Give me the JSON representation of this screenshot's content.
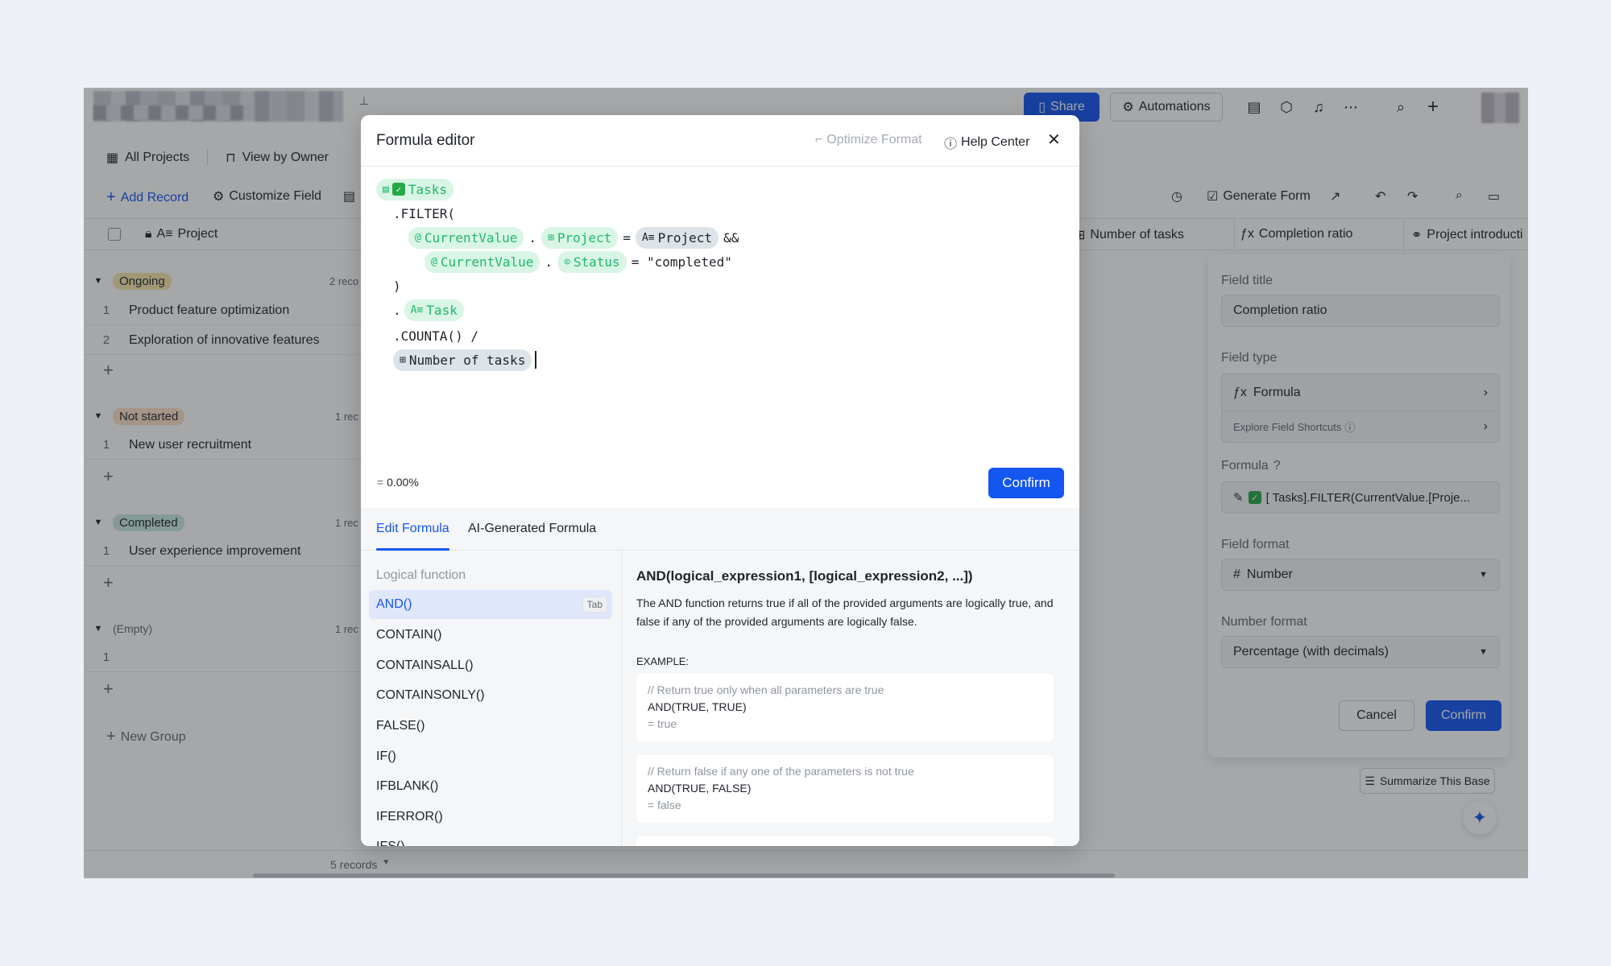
{
  "topbar": {
    "share_label": "Share",
    "automations_label": "Automations"
  },
  "views": [
    "All Projects",
    "View by Owner"
  ],
  "toolbar": {
    "add_record": "Add Record",
    "customize_field": "Customize Field",
    "generate_form": "Generate Form"
  },
  "grid": {
    "columns": [
      "Project",
      "Number of tasks",
      "Completion ratio",
      "Project introducti"
    ],
    "groups": [
      {
        "tag": "Ongoing",
        "count": "2 reco",
        "tag_color": "#f8e6ab",
        "rows": [
          "Product feature optimization",
          "Exploration of innovative features"
        ]
      },
      {
        "tag": "Not started",
        "count": "1 rec",
        "tag_color": "#fde2c6",
        "rows": [
          "New user recruitment"
        ]
      },
      {
        "tag": "Completed",
        "count": "1 rec",
        "tag_color": "#cae9e2",
        "rows": [
          "User experience improvement"
        ]
      },
      {
        "tag": "(Empty)",
        "count": "1 rec",
        "rows": [
          ""
        ]
      }
    ],
    "new_group": "New Group",
    "records": "5 records"
  },
  "field_panel": {
    "field_title_label": "Field title",
    "field_title_value": "Completion ratio",
    "field_type_label": "Field type",
    "field_type_value": "Formula",
    "shortcuts": "Explore Field Shortcuts",
    "formula_label": "Formula",
    "formula_value": "[ Tasks].FILTER(CurrentValue.[Proje...",
    "format_label": "Field format",
    "format_value": "Number",
    "number_format_label": "Number format",
    "number_format_value": "Percentage (with decimals)",
    "cancel": "Cancel",
    "confirm": "Confirm",
    "summarize": "Summarize This Base"
  },
  "modal": {
    "title": "Formula editor",
    "optimize": "Optimize Format",
    "help": "Help Center",
    "formula": {
      "tasks": "Tasks",
      "filter": ".FILTER(",
      "current_value": "CurrentValue",
      "project_field": "Project",
      "project_ref": "Project",
      "and_op": "&&",
      "status_field": "Status",
      "completed_str": "= \"completed\"",
      "close_paren": ")",
      "dot": ".",
      "task_field": "Task",
      "counta": ".COUNTA() /",
      "number_of_tasks": "Number of tasks",
      "eq": "="
    },
    "result": "0.00%",
    "result_prefix": "=",
    "confirm": "Confirm",
    "tabs": [
      "Edit Formula",
      "AI-Generated Formula"
    ],
    "category": "Logical function",
    "functions": [
      "AND()",
      "CONTAIN()",
      "CONTAINSALL()",
      "CONTAINSONLY()",
      "FALSE()",
      "IF()",
      "IFBLANK()",
      "IFERROR()",
      "IFS()"
    ],
    "tab_key": "Tab",
    "doc": {
      "signature": "AND(logical_expression1, [logical_expression2, ...])",
      "description": "The AND function returns true if all of the provided arguments are logically true, and false if any of the provided arguments are logically false.",
      "example_label": "EXAMPLE:",
      "examples": [
        {
          "comment": "// Return true only when all parameters are true",
          "code": "AND(TRUE, TRUE)",
          "result": "= true"
        },
        {
          "comment": "// Return false if any one of the parameters is not true",
          "code": "AND(TRUE, FALSE)",
          "result": "= false"
        }
      ]
    }
  }
}
